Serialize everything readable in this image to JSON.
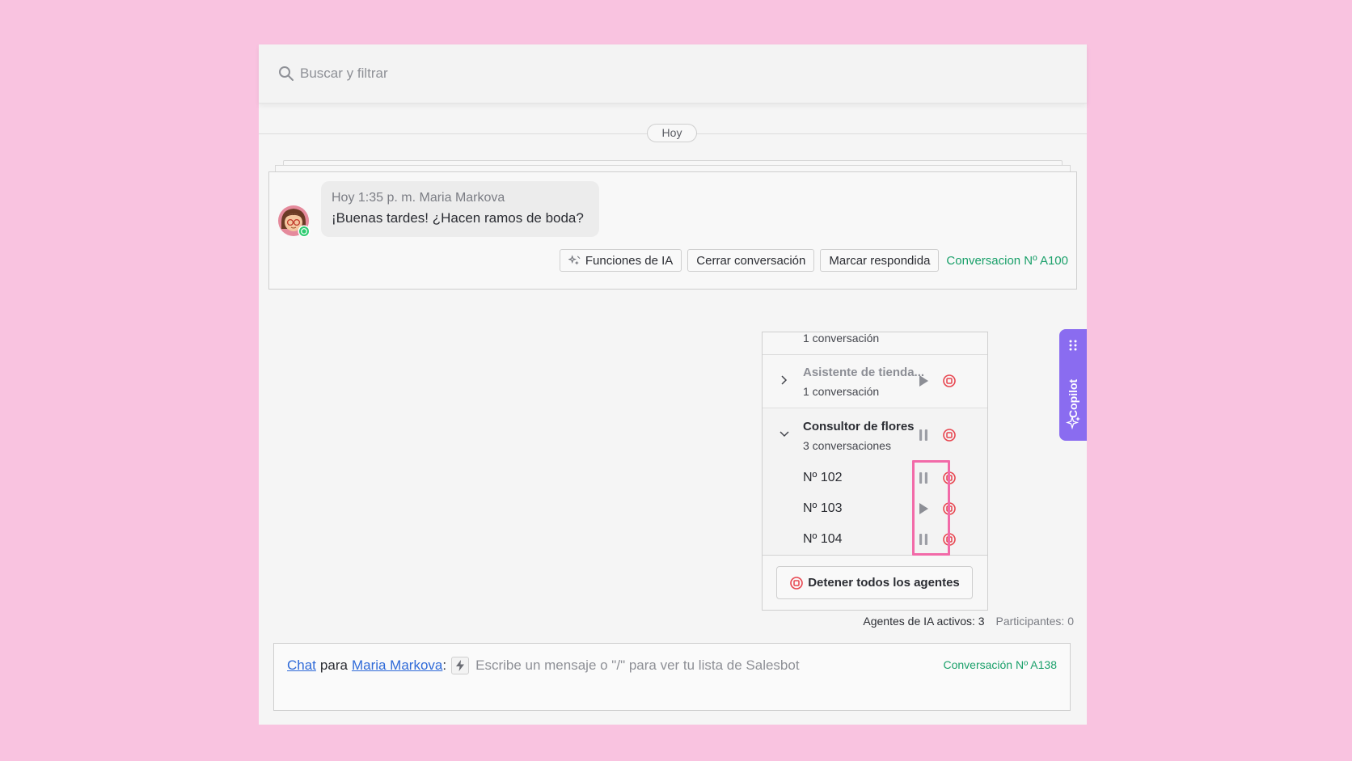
{
  "search": {
    "placeholder": "Buscar y filtrar"
  },
  "timeline": {
    "date_label": "Hoy"
  },
  "message": {
    "meta": "Hoy 1:35 p. m. Maria Markova",
    "text": "¡Buenas tardes! ¿Hacen ramos de boda?",
    "channel_icon": "whatsapp-icon"
  },
  "actions": {
    "ai_functions": "Funciones de IA",
    "close_conversation": "Cerrar conversación",
    "mark_answered": "Marcar respondida",
    "conversation_id": "Conversacion Nº A100"
  },
  "agents_panel": {
    "cut_row_sub": "1 conversación",
    "groups": [
      {
        "title": "Asistente de tienda...",
        "sub": "1 conversación",
        "state": "paused-play"
      },
      {
        "title": "Consultor de flores",
        "sub": "3 conversaciones",
        "state": "running"
      }
    ],
    "items": [
      {
        "label": "Nº 102",
        "state": "pause"
      },
      {
        "label": "Nº 103",
        "state": "play"
      },
      {
        "label": "Nº 104",
        "state": "pause"
      }
    ],
    "stop_all": "Detener todos los agentes"
  },
  "status": {
    "active_agents": "Agentes de IA activos: 3",
    "participants": "Participantes: 0"
  },
  "composer": {
    "chat_link": "Chat",
    "para": "para",
    "contact_link": "Maria Markova",
    "colon": ":",
    "placeholder": "Escribe un mensaje o \"/\" para ver tu lista de Salesbot",
    "conversation_id": "Conversación Nº A138"
  },
  "copilot": {
    "label": "Copilot"
  },
  "colors": {
    "background": "#f9c3e0",
    "accent_green": "#1aa06a",
    "link_blue": "#2f6ad8",
    "stop_red": "#e8454f",
    "copilot_purple": "#8a6cf0",
    "highlight_pink": "#f26aa8"
  }
}
